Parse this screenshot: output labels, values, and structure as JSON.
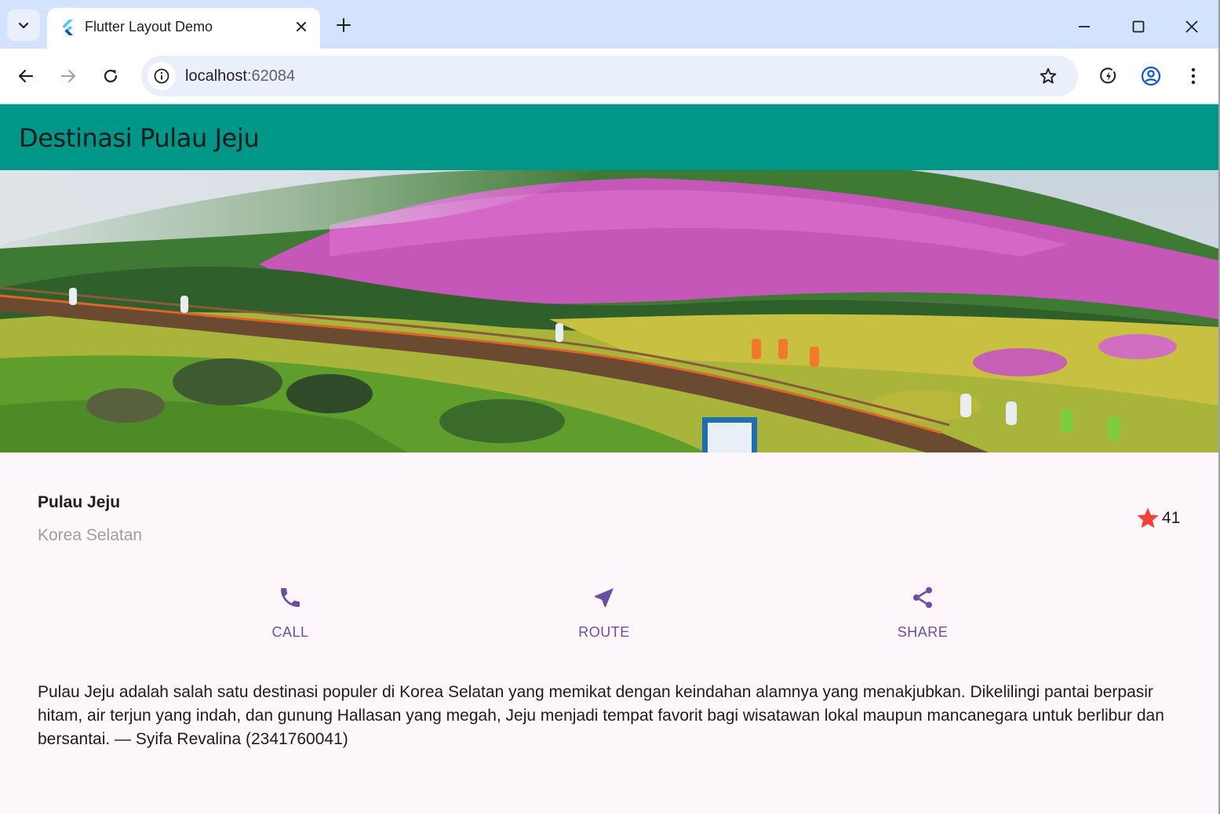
{
  "browser": {
    "tab_title": "Flutter Layout Demo",
    "url_host": "localhost",
    "url_port": ":62084"
  },
  "app": {
    "appbar_title": "Destinasi Pulau Jeju",
    "place": {
      "name": "Pulau Jeju",
      "country": "Korea Selatan",
      "favorite_count": "41"
    },
    "actions": [
      {
        "label": "CALL",
        "icon": "phone-icon"
      },
      {
        "label": "ROUTE",
        "icon": "near-me-icon"
      },
      {
        "label": "SHARE",
        "icon": "share-icon"
      }
    ],
    "description": "Pulau Jeju adalah salah satu destinasi populer di Korea Selatan yang memikat dengan keindahan alamnya yang menakjubkan. Dikelilingi pantai berpasir hitam, air terjun yang indah, dan gunung Hallasan yang megah, Jeju menjadi tempat favorit bagi wisatawan lokal maupun mancanegara untuk berlibur dan bersantai. — Syifa Revalina (2341760041)"
  },
  "colors": {
    "appbar": "#009688",
    "accent": "#6750a4",
    "star": "#f44336",
    "background": "#fdf7fb",
    "subtitle": "#9e9e9e"
  }
}
